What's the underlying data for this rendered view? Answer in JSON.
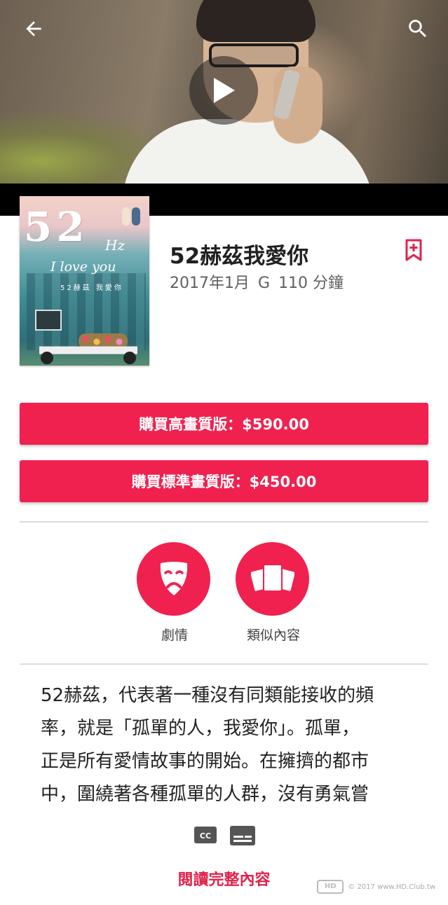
{
  "header": {
    "back_icon": "arrow-back-icon",
    "search_icon": "search-icon",
    "play_icon": "play-icon"
  },
  "movie": {
    "title": "52赫茲我愛你",
    "release": "2017年1月",
    "rating": "G",
    "duration": "110 分鐘",
    "poster": {
      "number": "52",
      "hz": "Hz",
      "tagline": "I love you",
      "subtitle": "52赫茲 我愛你"
    }
  },
  "wishlist_icon": "bookmark-add-icon",
  "purchase": {
    "hd_label": "購買高畫質版：$590.00",
    "sd_label": "購買標準畫質版：$450.00"
  },
  "actions": {
    "genre_label": "劇情",
    "genre_icon": "drama-mask-icon",
    "similar_label": "類似內容",
    "similar_icon": "cards-icon"
  },
  "description": {
    "lines": [
      "52赫茲，代表著一種沒有同類能接收的頻",
      "率，就是「孤單的人，我愛你」。孤單，",
      "正是所有愛情故事的開始。在擁擠的都市",
      "中，圍繞著各種孤單的人群，沒有勇氣嘗"
    ]
  },
  "badges": {
    "cc_label": "CC",
    "cc_icon": "closed-caption-icon",
    "subtitles_icon": "subtitles-icon"
  },
  "read_more_label": "閱讀完整內容",
  "watermark": {
    "logo": "HD",
    "text": "© 2017 www.HD.Club.tw"
  },
  "colors": {
    "accent": "#f0214f",
    "read_more": "#e0224c"
  }
}
